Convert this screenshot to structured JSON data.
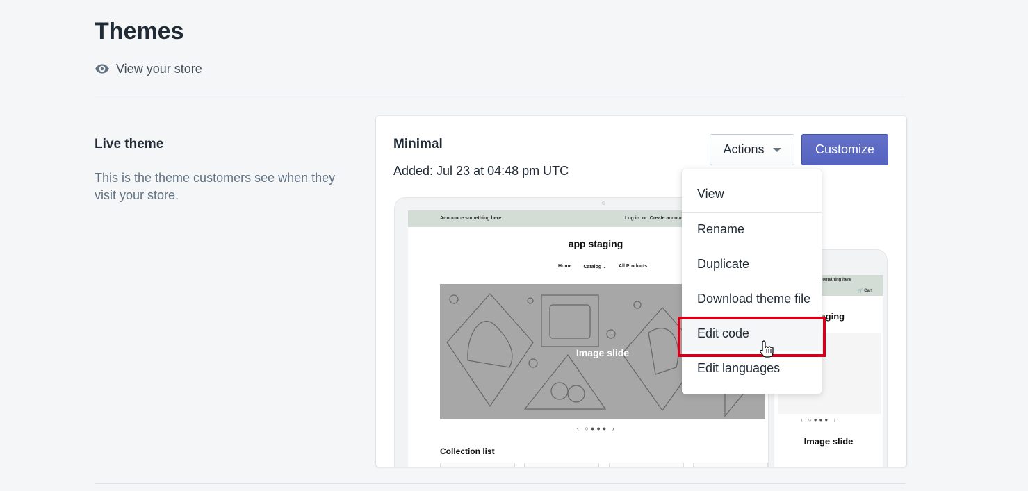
{
  "page": {
    "title": "Themes",
    "view_store_label": "View your store"
  },
  "live_theme_section": {
    "title": "Live theme",
    "description": "This is the theme customers see when they visit your store."
  },
  "theme_card": {
    "name": "Minimal",
    "added": "Added: Jul 23 at 04:48 pm UTC",
    "actions_label": "Actions",
    "customize_label": "Customize",
    "customize_color": "#5c6ac4"
  },
  "preview": {
    "announcement": "Announce something here",
    "login": "Log in",
    "or": "or",
    "create_account": "Create account",
    "store_name": "app staging",
    "nav": [
      "Home",
      "Catalog ⌄",
      "All Products"
    ],
    "slide_label": "Image slide",
    "slider_controls": "‹ ○●●● ›",
    "collection_list": "Collection list",
    "mobile_announcement": "something here",
    "mobile_cart": "Cart",
    "mobile_store_name": "staging",
    "mobile_slider_controls": "‹ ○●●● ›",
    "mobile_slide_label": "Image slide"
  },
  "actions_menu": {
    "items": [
      "View",
      "Rename",
      "Duplicate",
      "Download theme file",
      "Edit code",
      "Edit languages"
    ],
    "highlighted": "Edit code",
    "highlight_color": "#d0021b"
  }
}
